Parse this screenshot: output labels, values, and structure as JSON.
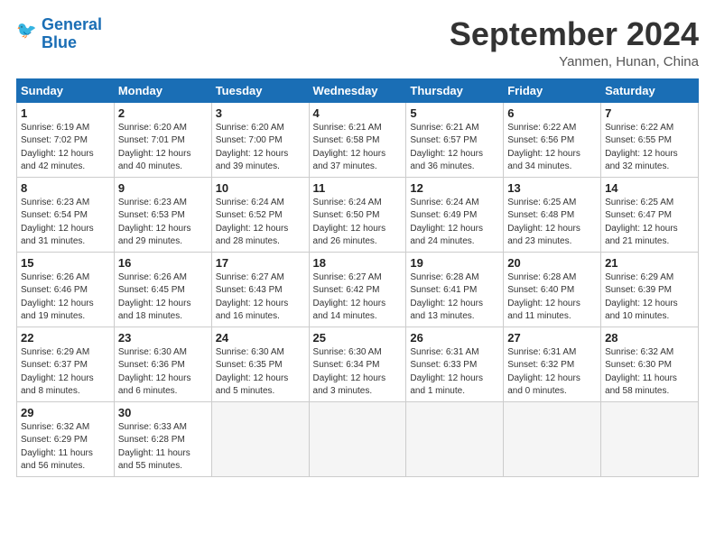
{
  "header": {
    "logo_line1": "General",
    "logo_line2": "Blue",
    "month_title": "September 2024",
    "location": "Yanmen, Hunan, China"
  },
  "calendar": {
    "days_of_week": [
      "Sunday",
      "Monday",
      "Tuesday",
      "Wednesday",
      "Thursday",
      "Friday",
      "Saturday"
    ],
    "weeks": [
      [
        {
          "day": "1",
          "info": "Sunrise: 6:19 AM\nSunset: 7:02 PM\nDaylight: 12 hours\nand 42 minutes."
        },
        {
          "day": "2",
          "info": "Sunrise: 6:20 AM\nSunset: 7:01 PM\nDaylight: 12 hours\nand 40 minutes."
        },
        {
          "day": "3",
          "info": "Sunrise: 6:20 AM\nSunset: 7:00 PM\nDaylight: 12 hours\nand 39 minutes."
        },
        {
          "day": "4",
          "info": "Sunrise: 6:21 AM\nSunset: 6:58 PM\nDaylight: 12 hours\nand 37 minutes."
        },
        {
          "day": "5",
          "info": "Sunrise: 6:21 AM\nSunset: 6:57 PM\nDaylight: 12 hours\nand 36 minutes."
        },
        {
          "day": "6",
          "info": "Sunrise: 6:22 AM\nSunset: 6:56 PM\nDaylight: 12 hours\nand 34 minutes."
        },
        {
          "day": "7",
          "info": "Sunrise: 6:22 AM\nSunset: 6:55 PM\nDaylight: 12 hours\nand 32 minutes."
        }
      ],
      [
        {
          "day": "8",
          "info": "Sunrise: 6:23 AM\nSunset: 6:54 PM\nDaylight: 12 hours\nand 31 minutes."
        },
        {
          "day": "9",
          "info": "Sunrise: 6:23 AM\nSunset: 6:53 PM\nDaylight: 12 hours\nand 29 minutes."
        },
        {
          "day": "10",
          "info": "Sunrise: 6:24 AM\nSunset: 6:52 PM\nDaylight: 12 hours\nand 28 minutes."
        },
        {
          "day": "11",
          "info": "Sunrise: 6:24 AM\nSunset: 6:50 PM\nDaylight: 12 hours\nand 26 minutes."
        },
        {
          "day": "12",
          "info": "Sunrise: 6:24 AM\nSunset: 6:49 PM\nDaylight: 12 hours\nand 24 minutes."
        },
        {
          "day": "13",
          "info": "Sunrise: 6:25 AM\nSunset: 6:48 PM\nDaylight: 12 hours\nand 23 minutes."
        },
        {
          "day": "14",
          "info": "Sunrise: 6:25 AM\nSunset: 6:47 PM\nDaylight: 12 hours\nand 21 minutes."
        }
      ],
      [
        {
          "day": "15",
          "info": "Sunrise: 6:26 AM\nSunset: 6:46 PM\nDaylight: 12 hours\nand 19 minutes."
        },
        {
          "day": "16",
          "info": "Sunrise: 6:26 AM\nSunset: 6:45 PM\nDaylight: 12 hours\nand 18 minutes."
        },
        {
          "day": "17",
          "info": "Sunrise: 6:27 AM\nSunset: 6:43 PM\nDaylight: 12 hours\nand 16 minutes."
        },
        {
          "day": "18",
          "info": "Sunrise: 6:27 AM\nSunset: 6:42 PM\nDaylight: 12 hours\nand 14 minutes."
        },
        {
          "day": "19",
          "info": "Sunrise: 6:28 AM\nSunset: 6:41 PM\nDaylight: 12 hours\nand 13 minutes."
        },
        {
          "day": "20",
          "info": "Sunrise: 6:28 AM\nSunset: 6:40 PM\nDaylight: 12 hours\nand 11 minutes."
        },
        {
          "day": "21",
          "info": "Sunrise: 6:29 AM\nSunset: 6:39 PM\nDaylight: 12 hours\nand 10 minutes."
        }
      ],
      [
        {
          "day": "22",
          "info": "Sunrise: 6:29 AM\nSunset: 6:37 PM\nDaylight: 12 hours\nand 8 minutes."
        },
        {
          "day": "23",
          "info": "Sunrise: 6:30 AM\nSunset: 6:36 PM\nDaylight: 12 hours\nand 6 minutes."
        },
        {
          "day": "24",
          "info": "Sunrise: 6:30 AM\nSunset: 6:35 PM\nDaylight: 12 hours\nand 5 minutes."
        },
        {
          "day": "25",
          "info": "Sunrise: 6:30 AM\nSunset: 6:34 PM\nDaylight: 12 hours\nand 3 minutes."
        },
        {
          "day": "26",
          "info": "Sunrise: 6:31 AM\nSunset: 6:33 PM\nDaylight: 12 hours\nand 1 minute."
        },
        {
          "day": "27",
          "info": "Sunrise: 6:31 AM\nSunset: 6:32 PM\nDaylight: 12 hours\nand 0 minutes."
        },
        {
          "day": "28",
          "info": "Sunrise: 6:32 AM\nSunset: 6:30 PM\nDaylight: 11 hours\nand 58 minutes."
        }
      ],
      [
        {
          "day": "29",
          "info": "Sunrise: 6:32 AM\nSunset: 6:29 PM\nDaylight: 11 hours\nand 56 minutes."
        },
        {
          "day": "30",
          "info": "Sunrise: 6:33 AM\nSunset: 6:28 PM\nDaylight: 11 hours\nand 55 minutes."
        },
        {
          "day": "",
          "info": ""
        },
        {
          "day": "",
          "info": ""
        },
        {
          "day": "",
          "info": ""
        },
        {
          "day": "",
          "info": ""
        },
        {
          "day": "",
          "info": ""
        }
      ]
    ]
  }
}
